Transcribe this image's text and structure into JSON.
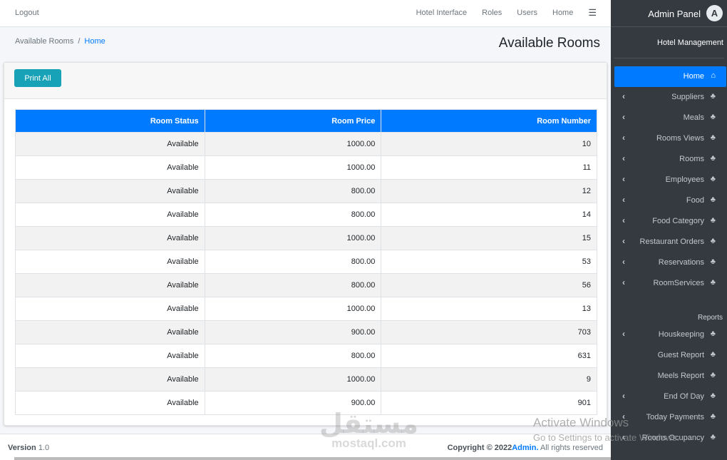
{
  "topbar": {
    "logout": "Logout",
    "nav": [
      "Hotel Interface",
      "Roles",
      "Users",
      "Home"
    ],
    "menu_icon": "hamburger-icon"
  },
  "breadcrumb": {
    "current": "Available Rooms",
    "separator": "/",
    "link": "Home"
  },
  "page_title": "Available Rooms",
  "print_button": "Print All",
  "table": {
    "headers": [
      "Room Status",
      "Room Price",
      "Room Number"
    ],
    "rows": [
      [
        "Available",
        "1000.00",
        "10"
      ],
      [
        "Available",
        "1000.00",
        "11"
      ],
      [
        "Available",
        "800.00",
        "12"
      ],
      [
        "Available",
        "800.00",
        "14"
      ],
      [
        "Available",
        "1000.00",
        "15"
      ],
      [
        "Available",
        "800.00",
        "53"
      ],
      [
        "Available",
        "800.00",
        "56"
      ],
      [
        "Available",
        "1000.00",
        "13"
      ],
      [
        "Available",
        "900.00",
        "703"
      ],
      [
        "Available",
        "800.00",
        "631"
      ],
      [
        "Available",
        "1000.00",
        "9"
      ],
      [
        "Available",
        "900.00",
        "901"
      ]
    ]
  },
  "footer": {
    "version_label": "Version",
    "version": "1.0",
    "copyright": "Copyright © 2022",
    "brand": "Admin.",
    "rights": "All rights reserved"
  },
  "sidebar": {
    "title": "Admin Panel",
    "logo_letter": "A",
    "subtitle": "Hotel Management",
    "items": [
      {
        "label": "Home",
        "icon": "home-icon",
        "active": true,
        "chevron": false
      },
      {
        "label": "Suppliers",
        "icon": "tree-icon",
        "chevron": true
      },
      {
        "label": "Meals",
        "icon": "tree-icon",
        "chevron": true
      },
      {
        "label": "Rooms Views",
        "icon": "tree-icon",
        "chevron": true
      },
      {
        "label": "Rooms",
        "icon": "tree-icon",
        "chevron": true
      },
      {
        "label": "Employees",
        "icon": "tree-icon",
        "chevron": true
      },
      {
        "label": "Food",
        "icon": "tree-icon",
        "chevron": true
      },
      {
        "label": "Food Category",
        "icon": "tree-icon",
        "chevron": true
      },
      {
        "label": "Restaurant Orders",
        "icon": "tree-icon",
        "chevron": true
      },
      {
        "label": "Reservations",
        "icon": "tree-icon",
        "chevron": true
      },
      {
        "label": "RoomServices",
        "icon": "tree-icon",
        "chevron": true
      }
    ],
    "reports_header": "Reports",
    "reports": [
      {
        "label": "Houskeeping",
        "icon": "tree-icon",
        "chevron": true
      },
      {
        "label": "Guest Report",
        "icon": "tree-icon",
        "chevron": false
      },
      {
        "label": "Meels Report",
        "icon": "tree-icon",
        "chevron": false
      },
      {
        "label": "End Of Day",
        "icon": "tree-icon",
        "chevron": true
      },
      {
        "label": "Today Payments",
        "icon": "tree-icon",
        "chevron": true
      },
      {
        "label": "Rooms Ocupancy",
        "icon": "tree-icon",
        "chevron": true
      }
    ]
  },
  "watermark": {
    "arabic": "مستقل",
    "latin": "mostaql.com"
  },
  "activate_windows": {
    "line1": "Activate Windows",
    "line2": "Go to Settings to activate Windows."
  }
}
